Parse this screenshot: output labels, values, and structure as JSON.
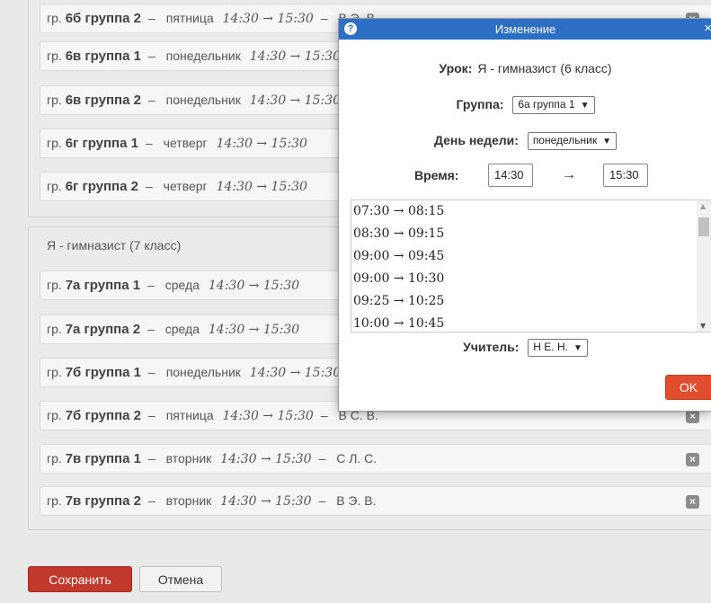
{
  "rows": [
    {
      "group": "6б группа 2",
      "day": "пятница",
      "time": "14:30 → 15:30",
      "teacher": "В Э. В."
    },
    {
      "group": "6в группа 1",
      "day": "понедельник",
      "time": "14:30 → 15:30",
      "teacher": ""
    },
    {
      "group": "6в группа 2",
      "day": "понедельник",
      "time": "14:30 → 15:30",
      "teacher": ""
    },
    {
      "group": "6г группа 1",
      "day": "четверг",
      "time": "14:30 → 15:30",
      "teacher": ""
    },
    {
      "group": "6г группа 2",
      "day": "четверг",
      "time": "14:30 → 15:30",
      "teacher": ""
    },
    {
      "group": "7а группа 1",
      "day": "среда",
      "time": "14:30 → 15:30",
      "teacher": ""
    },
    {
      "group": "7а группа 2",
      "day": "среда",
      "time": "14:30 → 15:30",
      "teacher": ""
    },
    {
      "group": "7б группа 1",
      "day": "понедельник",
      "time": "14:30 → 15:30",
      "teacher": ""
    },
    {
      "group": "7б группа 2",
      "day": "пятница",
      "time": "14:30 → 15:30",
      "teacher": "В С. В."
    },
    {
      "group": "7в группа 1",
      "day": "вторник",
      "time": "14:30 → 15:30",
      "teacher": "С Л. С."
    },
    {
      "group": "7в группа 2",
      "day": "вторник",
      "time": "14:30 → 15:30",
      "teacher": "В Э. В."
    }
  ],
  "row_prefix": "гр.",
  "section2_title": "Я - гимназист (7 класс)",
  "buttons": {
    "save": "Сохранить",
    "cancel": "Отмена"
  },
  "dialog": {
    "title": "Изменение",
    "help_icon": "?",
    "lesson_label": "Урок:",
    "lesson_value": "Я - гимназист (6 класс)",
    "group_label": "Группа:",
    "group_value": "6а группа 1",
    "day_label": "День недели:",
    "day_value": "понедельник",
    "time_label": "Время:",
    "time_from": "14:30",
    "time_to": "15:30",
    "time_arrow": "→",
    "time_options": [
      "07:30 → 08:15",
      "08:30 → 09:15",
      "09:00 → 09:45",
      "09:00 → 10:30",
      "09:25 → 10:25",
      "10:00 → 10:45"
    ],
    "teacher_label": "Учитель:",
    "teacher_value": "Н Е. Н.",
    "ok": "OK"
  },
  "colors": {
    "dialog_header": "#2c6fc4",
    "save_button": "#c0392b",
    "ok_button": "#e24d2f"
  }
}
